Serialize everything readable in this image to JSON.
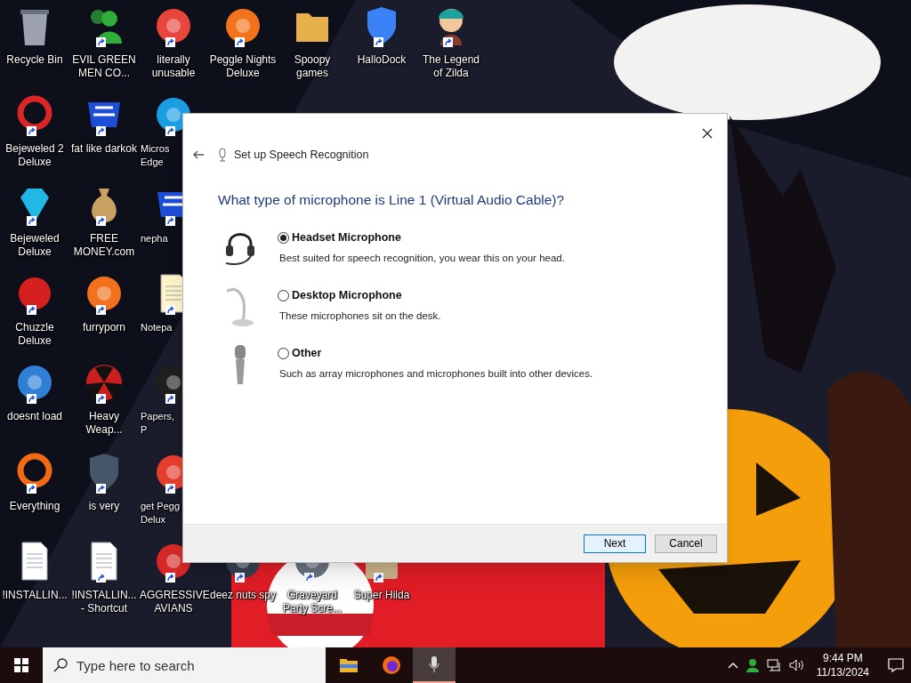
{
  "desktop": {
    "columns": [
      [
        {
          "label": "Recycle Bin",
          "kind": "trash",
          "color": "#9ca3af",
          "shortcut": false
        },
        {
          "label": "Bejeweled 2 Deluxe",
          "kind": "ring",
          "color": "#dc2626",
          "shortcut": true
        },
        {
          "label": "Bejeweled Deluxe",
          "kind": "gem",
          "color": "#22b8e6",
          "shortcut": true
        },
        {
          "label": "Chuzzle Deluxe",
          "kind": "blob",
          "color": "#d61f1f",
          "shortcut": true
        },
        {
          "label": "doesnt load",
          "kind": "circle",
          "color": "#2f7fd6",
          "shortcut": true
        },
        {
          "label": "Everything",
          "kind": "ring",
          "color": "#f26a12",
          "shortcut": true
        },
        {
          "label": "!INSTALLIN...",
          "kind": "document",
          "color": "#ffffff",
          "shortcut": false
        }
      ],
      [
        {
          "label": "EVIL GREEN MEN CO...",
          "kind": "people",
          "color": "#2fae3a",
          "shortcut": true
        },
        {
          "label": "fat like darkok",
          "kind": "badge",
          "color": "#1d4ed8",
          "shortcut": true
        },
        {
          "label": "FREE MONEY.com",
          "kind": "bag",
          "color": "#c8a060",
          "shortcut": true
        },
        {
          "label": "furryporn",
          "kind": "circle",
          "color": "#f2711c",
          "shortcut": true
        },
        {
          "label": "Heavy Weap...",
          "kind": "radiation",
          "color": "#cc1f1f",
          "shortcut": true
        },
        {
          "label": "is very",
          "kind": "shield",
          "color": "#475569",
          "shortcut": true
        },
        {
          "label": "!INSTALLIN... - Shortcut",
          "kind": "document",
          "color": "#ffffff",
          "shortcut": true
        }
      ],
      [
        {
          "label": "literally unusable",
          "kind": "circle",
          "color": "#e8453c",
          "shortcut": true
        },
        {
          "label": "Micros Edge",
          "kind": "circle",
          "color": "#1b9de2",
          "shortcut": true,
          "cut": true
        },
        {
          "label": "nepha",
          "kind": "badge",
          "color": "#1d4ed8",
          "shortcut": true,
          "cut": true
        },
        {
          "label": "Notepa",
          "kind": "document",
          "color": "#fef3c7",
          "shortcut": true,
          "cut": true
        },
        {
          "label": "Papers, P",
          "kind": "circle",
          "color": "#1f1f1f",
          "shortcut": true,
          "cut": true
        },
        {
          "label": "get Pegg Delux",
          "kind": "circle",
          "color": "#e53e2e",
          "shortcut": true,
          "cut": true
        },
        {
          "label": "AGGRESSIVE AVIANS",
          "kind": "circle",
          "color": "#d62828",
          "shortcut": true
        }
      ],
      [
        {
          "label": "Peggle Nights Deluxe",
          "kind": "circle",
          "color": "#f2731c",
          "shortcut": true
        },
        {
          "label": "deez nuts spy",
          "kind": "circle",
          "color": "#374151",
          "shortcut": true
        }
      ],
      [
        {
          "label": "Spoopy games",
          "kind": "folder",
          "color": "#e8b04a",
          "shortcut": false
        },
        {
          "label": "Graveyard Party Scre...",
          "kind": "circle",
          "color": "#6b7280",
          "shortcut": true
        }
      ],
      [
        {
          "label": "HalloDock",
          "kind": "shield",
          "color": "#3b82f6",
          "shortcut": true
        },
        {
          "label": "Super Hilda",
          "kind": "tile",
          "color": "#c9b48a",
          "shortcut": true
        }
      ],
      [
        {
          "label": "The Legend of Zilda",
          "kind": "figure",
          "color": "#1aa39a",
          "shortcut": true
        }
      ]
    ]
  },
  "dialog": {
    "title": "Set up Speech Recognition",
    "heading": "What type of microphone is Line 1 (Virtual Audio Cable)?",
    "options": [
      {
        "kind": "headset",
        "label": "Headset Microphone",
        "description": "Best suited for speech recognition, you wear this on your head.",
        "selected": true
      },
      {
        "kind": "desktop",
        "label": "Desktop Microphone",
        "description": "These microphones sit on the desk.",
        "selected": false
      },
      {
        "kind": "handheld",
        "label": "Other",
        "description": "Such as array microphones and microphones built into other devices.",
        "selected": false
      }
    ],
    "buttons": [
      {
        "label": "Next",
        "default": true
      },
      {
        "label": "Cancel",
        "default": false
      }
    ]
  },
  "taskbar": {
    "search": {
      "placeholder": "Type here to search"
    },
    "apps": [
      {
        "kind": "folder",
        "selected": false
      },
      {
        "kind": "browser",
        "selected": false
      },
      {
        "kind": "microphone",
        "selected": true
      }
    ],
    "time": "9:44 PM",
    "date": "11/13/2024"
  }
}
